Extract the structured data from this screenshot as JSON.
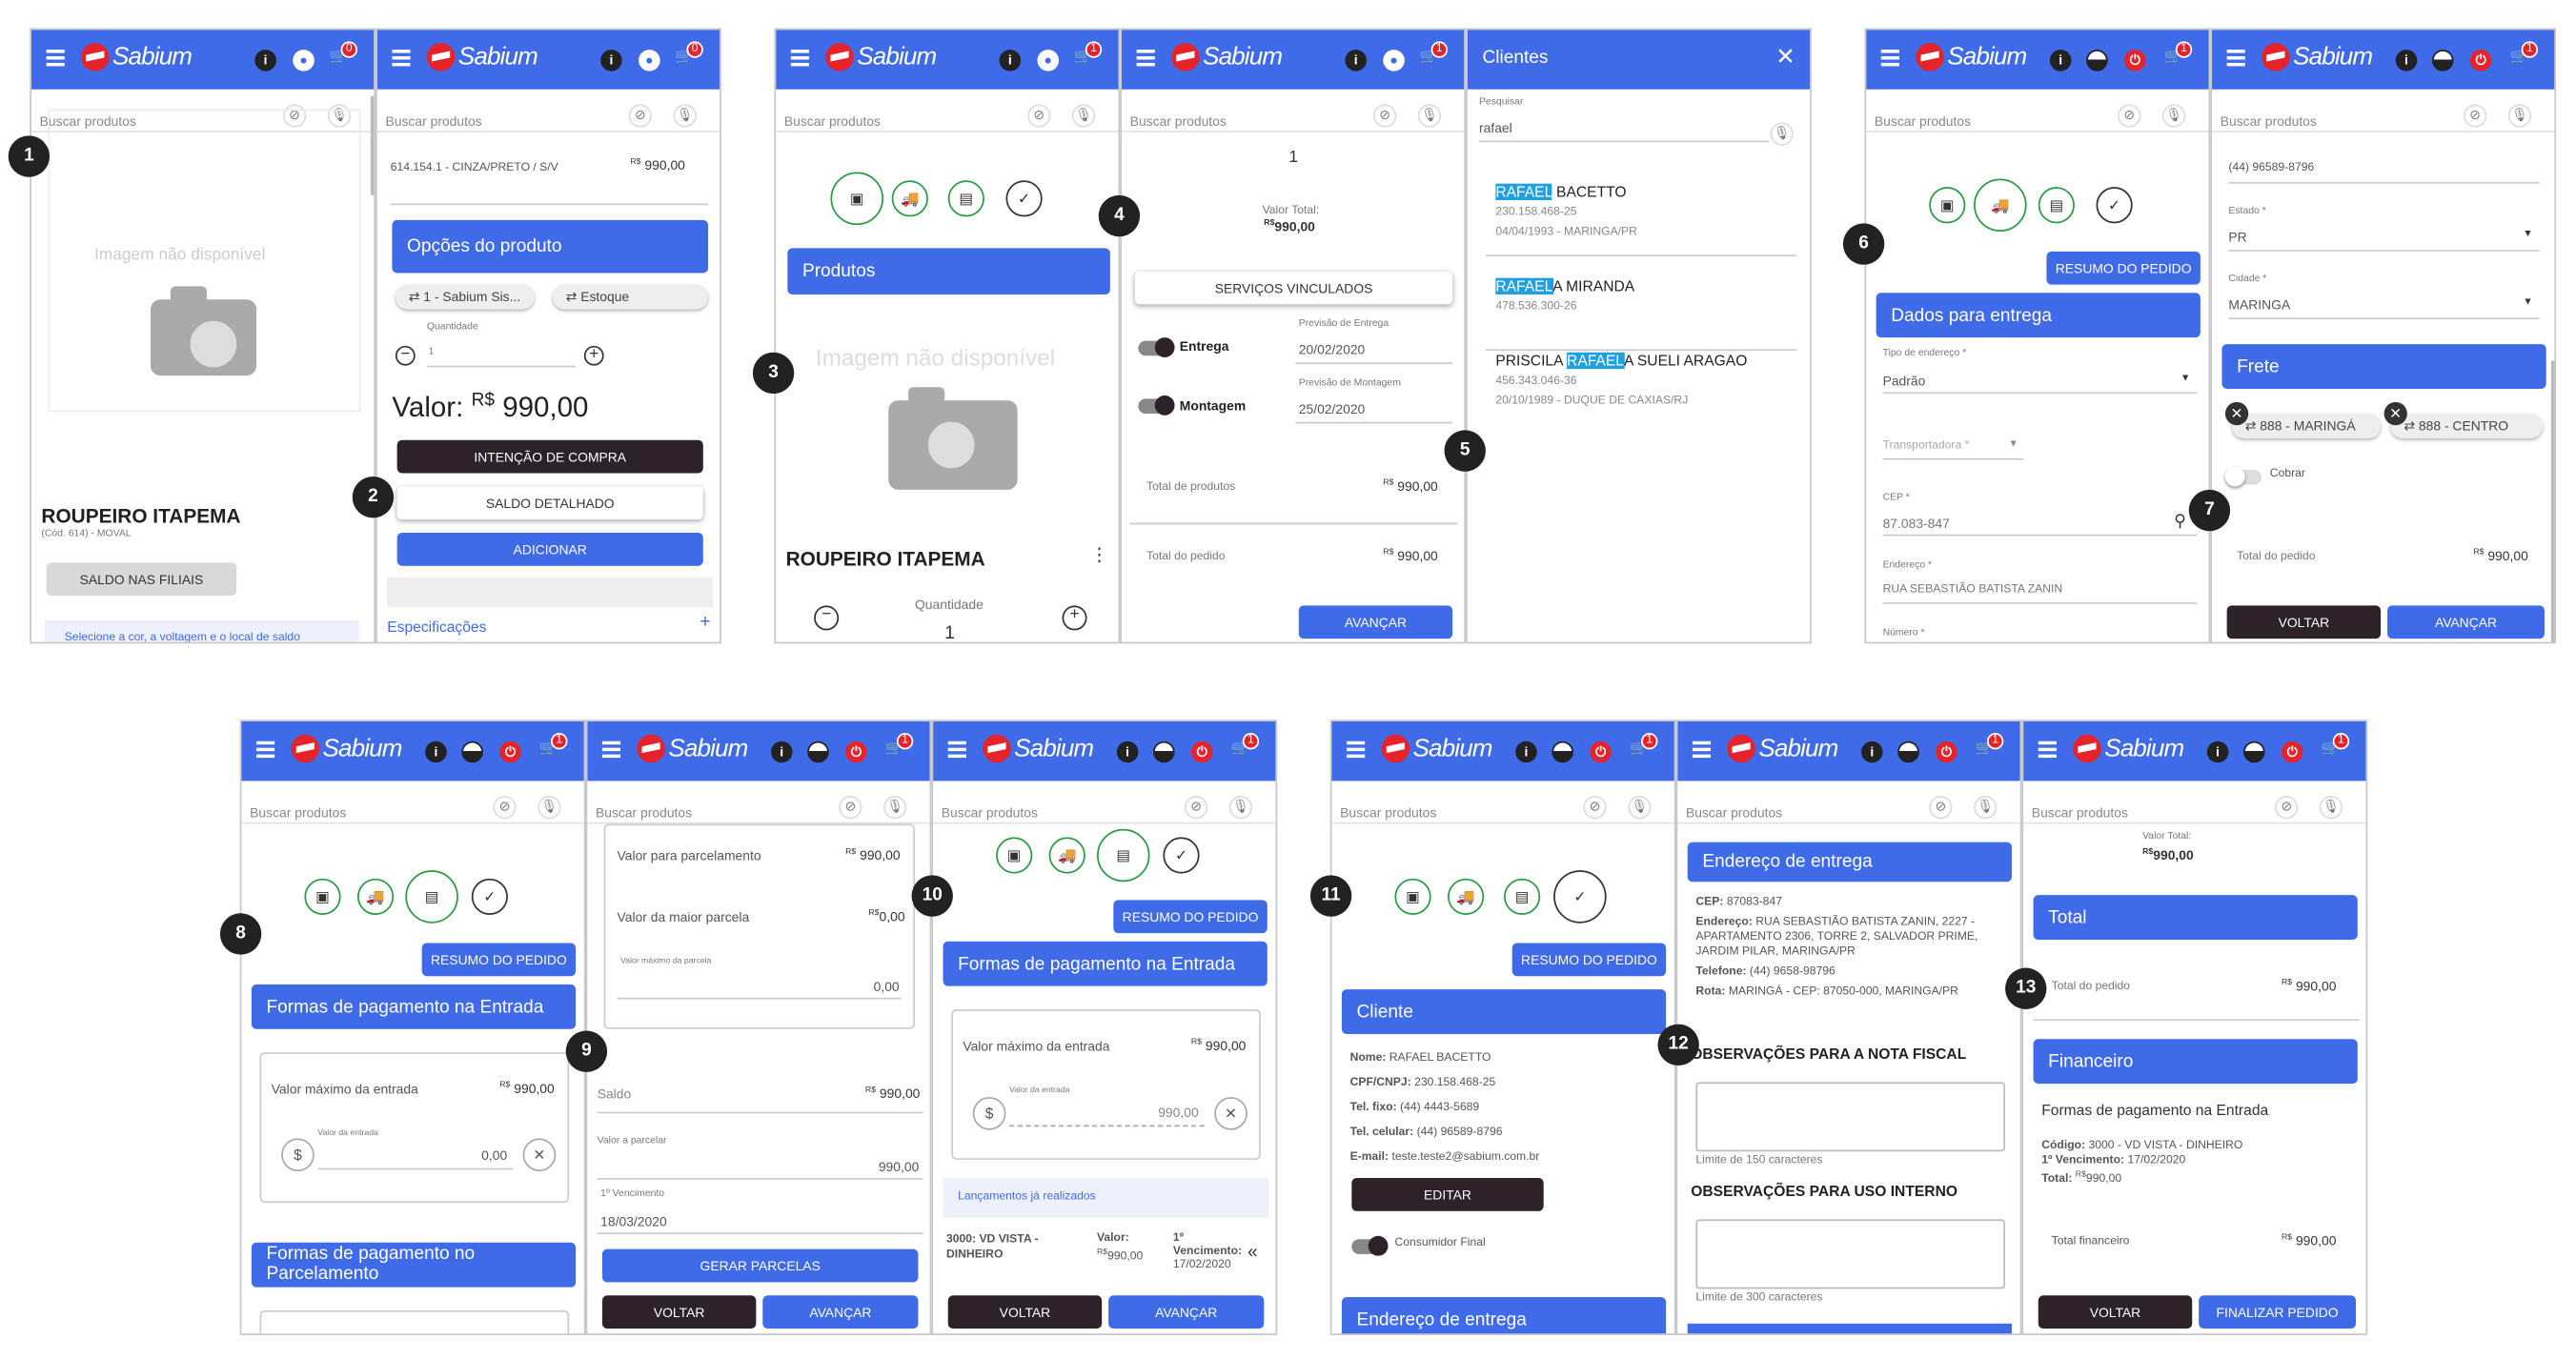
{
  "brand": {
    "logo": "Sabium",
    "cart_counts": [
      "0",
      "0",
      "1",
      "1",
      "1",
      "1",
      "1",
      "1",
      "1",
      "1",
      "1",
      "1"
    ]
  },
  "search_placeholder": "Buscar produtos",
  "steps": [
    "1",
    "2",
    "3",
    "4",
    "5",
    "6",
    "7",
    "8",
    "9",
    "10",
    "11",
    "12",
    "13"
  ],
  "p1": {
    "no_image": "Imagem não disponível",
    "product": "ROUPEIRO ITAPEMA",
    "code": "(Cód. 614) - MOVAL",
    "saldo_btn": "SALDO NAS FILIAIS",
    "hint": "Selecione a cor, a voltagem e o local de saldo"
  },
  "p2": {
    "variant": "614.154.1 - CINZA/PRETO / S/V",
    "currency": "R$",
    "price": "990,00",
    "options_title": "Opções do produto",
    "chip1": "1 - Sabium Sis...",
    "chip2": "Estoque",
    "qty_label": "Quantidade",
    "qty": "1",
    "valor_label": "Valor:",
    "valor": "990,00",
    "intent_btn": "INTENÇÃO DE COMPRA",
    "saldo_btn": "SALDO DETALHADO",
    "add_btn": "ADICIONAR",
    "specs": "Especificações"
  },
  "p3": {
    "title": "Produtos",
    "no_image": "Imagem não disponível",
    "product": "ROUPEIRO ITAPEMA",
    "qty_label": "Quantidade",
    "qty": "1"
  },
  "p4": {
    "qty": "1",
    "total_label": "Valor Total:",
    "total": "990,00",
    "services_btn": "SERVIÇOS VINCULADOS",
    "entrega": "Entrega",
    "montagem": "Montagem",
    "prev_entrega_label": "Previsão de Entrega",
    "prev_entrega": "20/02/2020",
    "prev_montagem_label": "Previsão de Montagem",
    "prev_montagem": "25/02/2020",
    "total_produtos": "Total de produtos",
    "total_pedido": "Total do pedido",
    "price": "990,00",
    "advance": "AVANÇAR"
  },
  "p5": {
    "title": "Clientes",
    "search_label": "Pesquisar",
    "search_value": "rafael",
    "clients": [
      {
        "pre": "",
        "hl": "RAFAEL",
        "post": " BACETTO",
        "doc": "230.158.468-25",
        "extra": "04/04/1993 - MARINGA/PR"
      },
      {
        "pre": "",
        "hl": "RAFAEL",
        "post": "A MIRANDA",
        "doc": "478.536.300-26",
        "extra": ""
      },
      {
        "pre": "PRISCILA ",
        "hl": "RAFAEL",
        "post": "A SUELI ARAGAO",
        "doc": "456.343.046-36",
        "extra": "20/10/1989 - DUQUE DE CAXIAS/RJ"
      }
    ]
  },
  "p6": {
    "resumo": "RESUMO DO PEDIDO",
    "title": "Dados para entrega",
    "tipo_label": "Tipo de endereço *",
    "tipo": "Padrão",
    "transp": "Transportadora *",
    "cep_label": "CEP *",
    "cep": "87.083-847",
    "end_label": "Endereço *",
    "end": "RUA SEBASTIÃO BATISTA ZANIN",
    "num_label": "Número *"
  },
  "p7": {
    "phone": "(44) 96589-8796",
    "estado_label": "Estado *",
    "estado": "PR",
    "cidade_label": "Cidade *",
    "cidade": "MARINGA",
    "frete": "Frete",
    "chip1": "888 - MARINGÁ",
    "chip2": "888 - CENTRO",
    "cobrar": "Cobrar",
    "total_pedido": "Total do pedido",
    "price": "990,00",
    "back": "VOLTAR",
    "advance": "AVANÇAR"
  },
  "p8": {
    "resumo": "RESUMO DO PEDIDO",
    "title": "Formas de pagamento na Entrada",
    "max_label": "Valor máximo da entrada",
    "max": "990,00",
    "valor_label": "Valor da entrada",
    "valor": "0,00",
    "title2": "Formas de pagamento no Parcelamento"
  },
  "p9": {
    "parcel_label": "Valor para parcelamento",
    "parcel": "990,00",
    "maior_label": "Valor da maior parcela",
    "maior": "0,00",
    "max_parcela_label": "Valor máximo da parcela",
    "max_parcela": "0,00",
    "saldo_label": "Saldo",
    "saldo": "990,00",
    "parcelar_label": "Valor a parcelar",
    "parcelar": "990,00",
    "venc_label": "1º Vencimento",
    "venc": "18/03/2020",
    "gerar": "GERAR PARCELAS",
    "back": "VOLTAR",
    "advance": "AVANÇAR"
  },
  "p10": {
    "resumo": "RESUMO DO PEDIDO",
    "title": "Formas de pagamento na Entrada",
    "max_label": "Valor máximo da entrada",
    "max": "990,00",
    "valor_label": "Valor da entrada",
    "valor": "990,00",
    "lanc": "Lançamentos já realizados",
    "forma": "3000: VD VISTA - DINHEIRO",
    "valor_k": "Valor:",
    "valor_v": "990,00",
    "venc_k": "1º Vencimento:",
    "venc_v": "17/02/2020",
    "back": "VOLTAR",
    "advance": "AVANÇAR"
  },
  "p11": {
    "resumo": "RESUMO DO PEDIDO",
    "title": "Cliente",
    "nome_k": "Nome:",
    "nome": "RAFAEL BACETTO",
    "cpf_k": "CPF/CNPJ:",
    "cpf": "230.158.468-25",
    "fixo_k": "Tel. fixo:",
    "fixo": "(44) 4443-5689",
    "cel_k": "Tel. celular:",
    "cel": "(44) 96589-8796",
    "email_k": "E-mail:",
    "email": "teste.teste2@sabium.com.br",
    "edit": "EDITAR",
    "consumidor": "Consumidor Final",
    "title2": "Endereço de entrega"
  },
  "p12": {
    "title": "Endereço de entrega",
    "cep_k": "CEP:",
    "cep": "87083-847",
    "end_k": "Endereço:",
    "end": "RUA SEBASTIÃO BATISTA ZANIN, 2227 - APARTAMENTO 2306, TORRE 2, SALVADOR PRIME, JARDIM PILAR, MARINGA/PR",
    "tel_k": "Telefone:",
    "tel": "(44) 9658-98796",
    "rota_k": "Rota:",
    "rota": "MARINGÁ - CEP: 87050-000, MARINGA/PR",
    "obs_nf": "OBSERVAÇÕES PARA A NOTA FISCAL",
    "lim1": "Limite de 150 caracteres",
    "obs_int": "OBSERVAÇÕES PARA USO INTERNO",
    "lim2": "Limite de 300 caracteres"
  },
  "p13": {
    "top_label": "Valor Total:",
    "top": "990,00",
    "total": "Total",
    "total_pedido": "Total do pedido",
    "price": "990,00",
    "fin": "Financeiro",
    "formas": "Formas de pagamento na Entrada",
    "cod_k": "Código:",
    "cod": "3000 - VD VISTA - DINHEIRO",
    "venc_k": "1º Vencimento:",
    "venc": "17/02/2020",
    "tot_k": "Total:",
    "tot": "990,00",
    "total_fin": "Total financeiro",
    "back": "VOLTAR",
    "finish": "FINALIZAR PEDIDO"
  }
}
